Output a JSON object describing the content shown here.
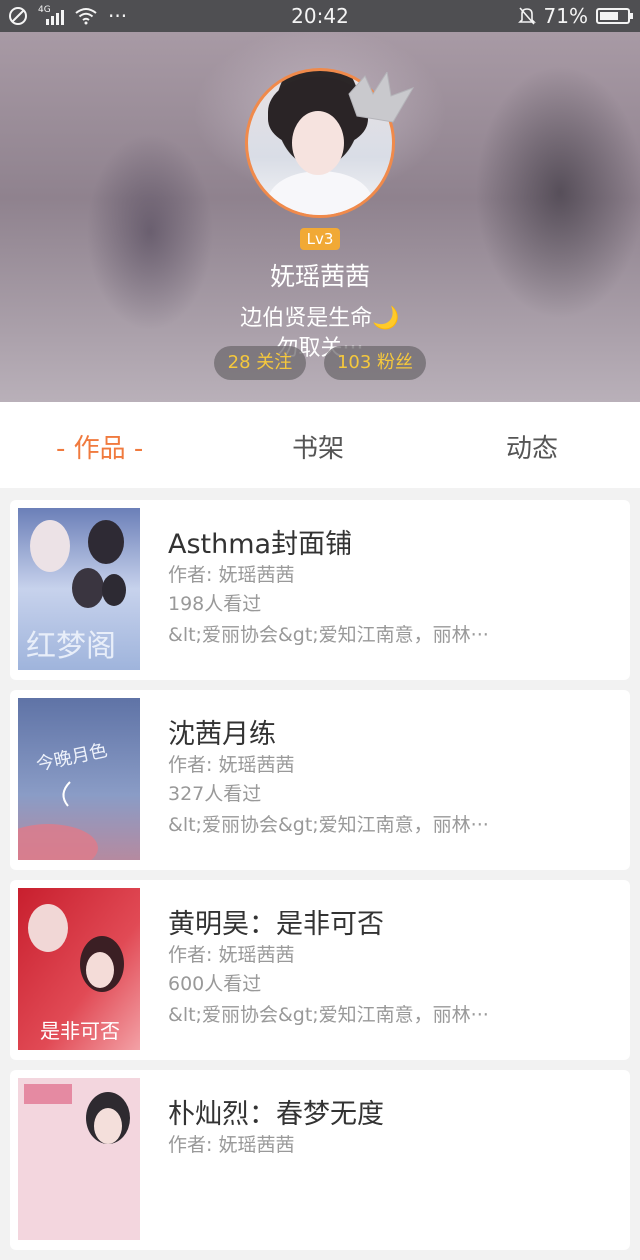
{
  "status_bar": {
    "time": "20:42",
    "network": "4G",
    "battery_text": "71%",
    "battery_level": 0.71,
    "more": "···"
  },
  "profile": {
    "level": "Lv3",
    "name": "妩瑶茜茜",
    "signature_line1": "边伯贤是生命🌙",
    "signature_line2": "勿取关···",
    "following": "28 关注",
    "fans": "103 粉丝",
    "accent_color": "#f08a4b",
    "badge_color": "#f1a935"
  },
  "tabs": [
    {
      "label": "- 作品 -",
      "active": true
    },
    {
      "label": "书架",
      "active": false
    },
    {
      "label": "动态",
      "active": false
    }
  ],
  "works": [
    {
      "title": "Asthma封面铺",
      "author": "作者: 妩瑶茜茜",
      "views": "198人看过",
      "tags": "&lt;爱丽协会&gt;爱知江南意，丽林···",
      "cover_text": "红梦阁"
    },
    {
      "title": "沈茜月练",
      "author": "作者: 妩瑶茜茜",
      "views": "327人看过",
      "tags": "&lt;爱丽协会&gt;爱知江南意，丽林···",
      "cover_text": "今晚月色"
    },
    {
      "title": "黄明昊：是非可否",
      "author": "作者: 妩瑶茜茜",
      "views": "600人看过",
      "tags": "&lt;爱丽协会&gt;爱知江南意，丽林···",
      "cover_text": "是非可否"
    },
    {
      "title": "朴灿烈：春梦无度",
      "author": "作者: 妩瑶茜茜",
      "views": "",
      "tags": "",
      "cover_text": ""
    }
  ]
}
